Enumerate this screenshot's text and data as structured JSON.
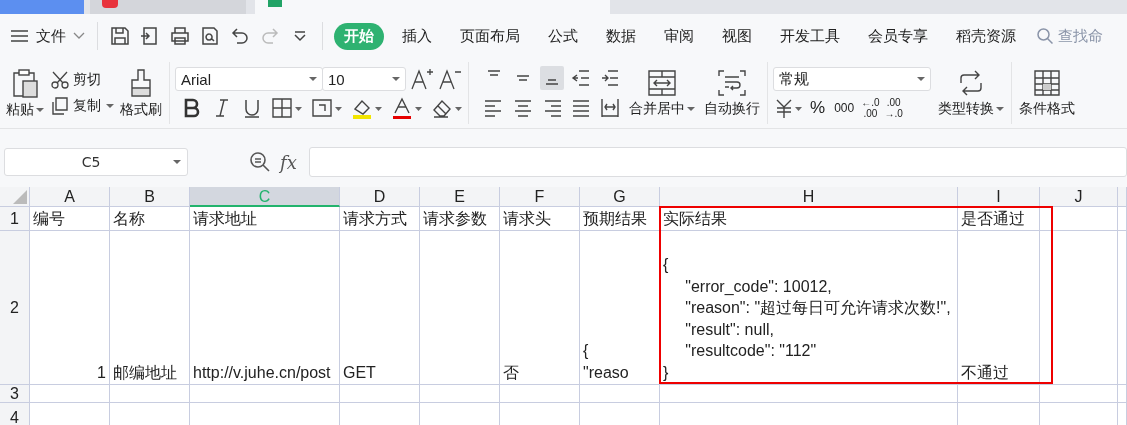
{
  "menu": {
    "file_label": "文件",
    "tabs": [
      {
        "label": "开始",
        "selected": true
      },
      {
        "label": "插入",
        "selected": false
      },
      {
        "label": "页面布局",
        "selected": false
      },
      {
        "label": "公式",
        "selected": false
      },
      {
        "label": "数据",
        "selected": false
      },
      {
        "label": "审阅",
        "selected": false
      },
      {
        "label": "视图",
        "selected": false
      },
      {
        "label": "开发工具",
        "selected": false
      },
      {
        "label": "会员专享",
        "selected": false
      },
      {
        "label": "稻壳资源",
        "selected": false
      }
    ],
    "search": {
      "placeholder": "查找命"
    }
  },
  "ribbon": {
    "paste": "粘贴",
    "cut": "剪切",
    "copy": "复制",
    "format_painter": "格式刷",
    "font_name": "Arial",
    "font_size": "10",
    "merge": "合并居中",
    "wrap": "自动换行",
    "number_format": "常规",
    "number_buttons": [
      "%",
      "000"
    ],
    "decimal_buttons": [
      {
        "top": "←.0",
        "bottom": ".00"
      },
      {
        "top": ".00",
        "bottom": "→.0"
      }
    ],
    "convert": "类型转换",
    "conditional": "条件格式"
  },
  "formula_bar": {
    "name_box": "C5",
    "fx": "fx"
  },
  "sheet": {
    "columns": [
      {
        "label": "A",
        "selected": false
      },
      {
        "label": "B",
        "selected": false
      },
      {
        "label": "C",
        "selected": true
      },
      {
        "label": "D",
        "selected": false
      },
      {
        "label": "E",
        "selected": false
      },
      {
        "label": "F",
        "selected": false
      },
      {
        "label": "G",
        "selected": false
      },
      {
        "label": "H",
        "selected": false
      },
      {
        "label": "I",
        "selected": false
      },
      {
        "label": "J",
        "selected": false
      }
    ],
    "rows": [
      {
        "label": "1",
        "cells": [
          {
            "text": "编号",
            "kind": "text"
          },
          {
            "text": "名称",
            "kind": "text"
          },
          {
            "text": "请求地址",
            "kind": "text"
          },
          {
            "text": "请求方式",
            "kind": "text"
          },
          {
            "text": "请求参数",
            "kind": "text"
          },
          {
            "text": "请求头",
            "kind": "text"
          },
          {
            "text": "预期结果",
            "kind": "text"
          },
          {
            "text": "实际结果",
            "kind": "text"
          },
          {
            "text": "是否通过",
            "kind": "text"
          },
          null
        ]
      },
      {
        "label": "2",
        "cells": [
          {
            "text": "1",
            "kind": "number"
          },
          {
            "text": "邮编地址",
            "kind": "text"
          },
          {
            "text": "http://v.juhe.cn/post",
            "kind": "text"
          },
          {
            "text": "GET",
            "kind": "text"
          },
          null,
          {
            "text": "否",
            "kind": "text"
          },
          {
            "text": "{     \"reaso",
            "kind": "text"
          },
          {
            "text": "{\n     \"error_code\": 10012,\n     \"reason\": \"超过每日可允许请求次数!\",\n     \"result\": null,\n     \"resultcode\": \"112\"\n}",
            "kind": "text"
          },
          {
            "text": "不通过",
            "kind": "text"
          },
          null
        ]
      },
      {
        "label": "3",
        "cells": [
          null,
          null,
          null,
          null,
          null,
          null,
          null,
          null,
          null,
          null
        ]
      },
      {
        "label": "4",
        "cells": [
          null,
          null,
          null,
          null,
          null,
          null,
          null,
          null,
          null,
          null
        ]
      }
    ]
  }
}
